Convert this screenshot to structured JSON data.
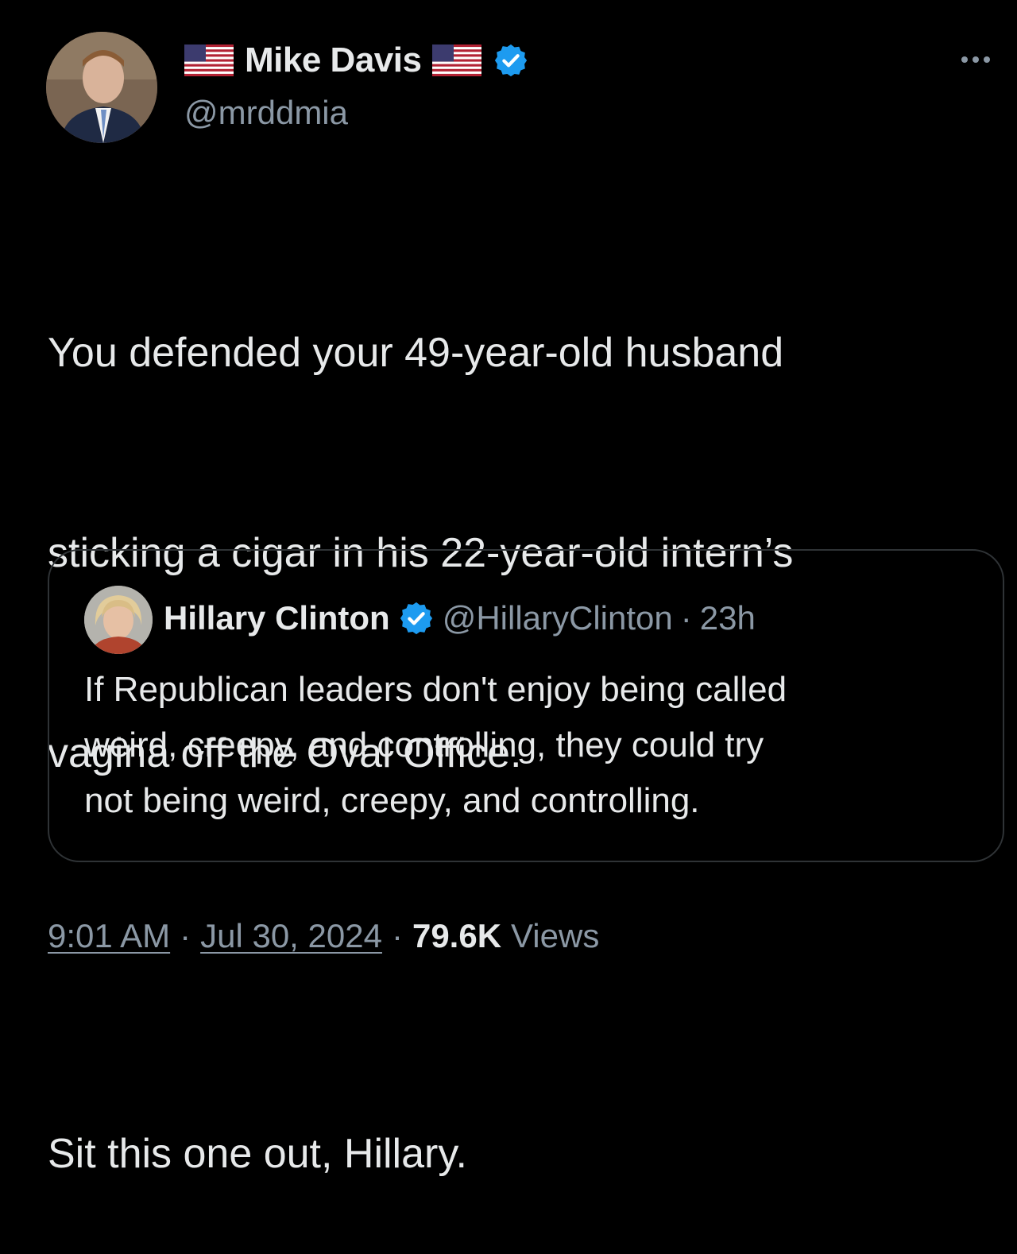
{
  "author": {
    "display_name": "Mike Davis",
    "handle": "@mrddmia",
    "flag_icon": "us-flag-icon",
    "verified_icon": "verified-badge-icon",
    "verified_color": "#1d9bf0"
  },
  "more_menu_icon": "more-options-icon",
  "tweet": {
    "line1": "You defended your 49-year-old husband",
    "line2": "sticking a cigar in his 22-year-old intern’s",
    "line3": "vagina off the Oval Office.",
    "line4": "Sit this one out, Hillary."
  },
  "quote": {
    "display_name": "Hillary Clinton",
    "handle": "@HillaryClinton",
    "separator": "·",
    "time": "23h",
    "line1": "If Republican leaders don't enjoy being called",
    "line2": "weird, creepy, and controlling, they could try",
    "line3": "not being weird, creepy, and controlling."
  },
  "meta": {
    "time": "9:01 AM",
    "sep1": "·",
    "date": "Jul 30, 2024",
    "sep2": "·",
    "views_count": "79.6K",
    "views_label": "Views"
  },
  "colors": {
    "background": "#000000",
    "text": "#e7e9ea",
    "muted": "#8b98a5",
    "border": "#2f3336"
  }
}
